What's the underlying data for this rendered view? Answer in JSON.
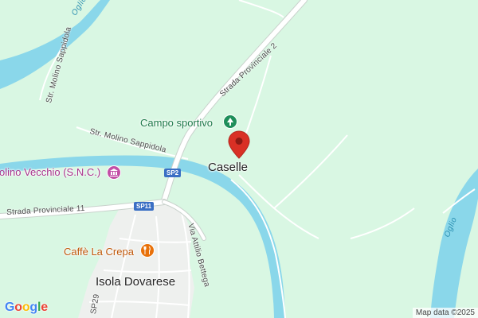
{
  "map": {
    "colors": {
      "land": "#d9f7e3",
      "water": "#8ad7ea",
      "urban": "#eef0ee",
      "road": "#ffffff",
      "road_casing": "#c9d2cc",
      "pin": "#d93025",
      "park_icon": "#1e8e5a",
      "culture_icon": "#c24fa6",
      "food_icon": "#e8710a"
    },
    "water_labels": [
      {
        "text": "Oglio"
      },
      {
        "text": "Oglio"
      }
    ],
    "road_labels": [
      {
        "text": "Strada Provinciale 2"
      },
      {
        "text": "Str. Molino Sappidola"
      },
      {
        "text": "Str. Molino Sappidola"
      },
      {
        "text": "Strada Provinciale 11"
      },
      {
        "text": "Via Attilio Bettega"
      },
      {
        "text": "SP29"
      }
    ],
    "road_shields": [
      {
        "text": "SP2"
      },
      {
        "text": "SP11"
      }
    ],
    "pois": [
      {
        "name": "Campo sportivo",
        "icon": "tree-icon"
      },
      {
        "name": "Molino Vecchio (S.N.C.)",
        "icon": "museum-icon",
        "visible_text": "olino Vecchio (S.N.C.)"
      },
      {
        "name": "Caffè La Crepa",
        "icon": "fork-knife-icon"
      }
    ],
    "places": [
      {
        "name": "Caselle"
      },
      {
        "name": "Isola Dovarese"
      }
    ],
    "marker": {
      "icon": "location-pin-icon"
    },
    "branding": {
      "logo_letters": [
        "G",
        "o",
        "o",
        "g",
        "l",
        "e"
      ],
      "logo_colors": [
        "#4285F4",
        "#EA4335",
        "#FBBC05",
        "#4285F4",
        "#34A853",
        "#EA4335"
      ],
      "attribution": "Map data ©2025"
    }
  }
}
